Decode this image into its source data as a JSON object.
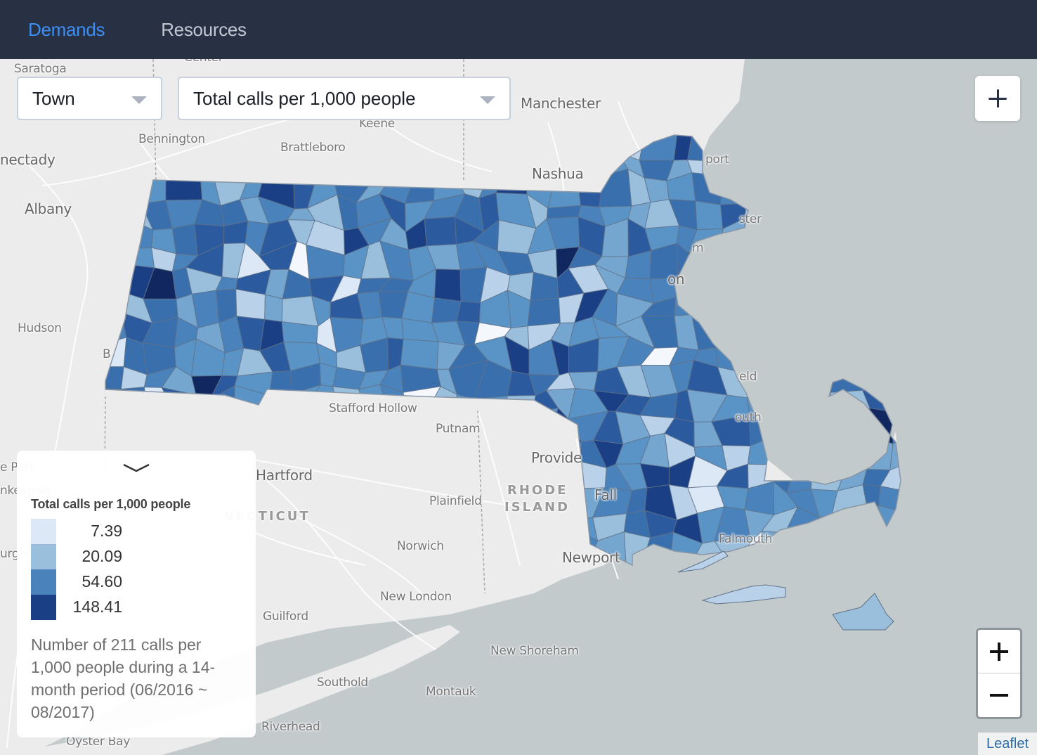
{
  "navbar": {
    "tabs": [
      {
        "label": "Demands",
        "active": true
      },
      {
        "label": "Resources",
        "active": false
      }
    ]
  },
  "controls": {
    "geography_select": {
      "value": "Town"
    },
    "metric_select": {
      "value": "Total calls per 1,000 people"
    },
    "expand_button": {
      "icon": "plus-icon"
    }
  },
  "legend": {
    "title": "Total calls per 1,000 people",
    "bins": [
      {
        "value": "7.39",
        "color": "#dce8f5"
      },
      {
        "value": "20.09",
        "color": "#9abfdc"
      },
      {
        "value": "54.60",
        "color": "#4a82bb"
      },
      {
        "value": "148.41",
        "color": "#1b3f85"
      }
    ],
    "description": "Number of 211 calls per 1,000 people during a 14-month period (06/2016 ~ 08/2017)",
    "collapse_icon": "chevron-down-icon"
  },
  "colors": {
    "accent": "#3d8ef0",
    "navbar_bg": "#283044",
    "water": "#c3cacc",
    "land": "#ececec",
    "choropleth_scale": [
      "#f4f8fd",
      "#dce8f5",
      "#b9d2ea",
      "#9abfdc",
      "#74a6d0",
      "#5a93c6",
      "#4a82bb",
      "#3a6fae",
      "#2b5a9e",
      "#1b3f85",
      "#10285f"
    ]
  },
  "map": {
    "labels": [
      {
        "text": "Saratoga"
      },
      {
        "text": "Center"
      },
      {
        "text": "Manchester"
      },
      {
        "text": "Keene"
      },
      {
        "text": "Bennington"
      },
      {
        "text": "Brattleboro"
      },
      {
        "text": "nectady"
      },
      {
        "text": "Nashua"
      },
      {
        "text": "Albany"
      },
      {
        "text": "Hudson"
      },
      {
        "text": "Stafford Hollow"
      },
      {
        "text": "Putnam"
      },
      {
        "text": "Provide"
      },
      {
        "text": "Hartford"
      },
      {
        "text": "RHODE"
      },
      {
        "text": "ISLAND"
      },
      {
        "text": "Plainfield"
      },
      {
        "text": "Fall"
      },
      {
        "text": "NECTICUT"
      },
      {
        "text": "Norwich"
      },
      {
        "text": "Newport"
      },
      {
        "text": "New London"
      },
      {
        "text": "Guilford"
      },
      {
        "text": "New Shoreham"
      },
      {
        "text": "Southold"
      },
      {
        "text": "Montauk"
      },
      {
        "text": "Riverhead"
      },
      {
        "text": "Oyster Bay"
      },
      {
        "text": "port"
      },
      {
        "text": "ster"
      },
      {
        "text": "m"
      },
      {
        "text": "on"
      },
      {
        "text": "eld"
      },
      {
        "text": "outh"
      },
      {
        "text": "Falmouth"
      },
      {
        "text": "B"
      },
      {
        "text": "e Park"
      },
      {
        "text": "nkeepsie"
      },
      {
        "text": "urgh"
      }
    ]
  },
  "zoom": {
    "in_icon": "plus-icon",
    "out_icon": "minus-icon"
  },
  "attribution": {
    "text": "Leaflet"
  }
}
